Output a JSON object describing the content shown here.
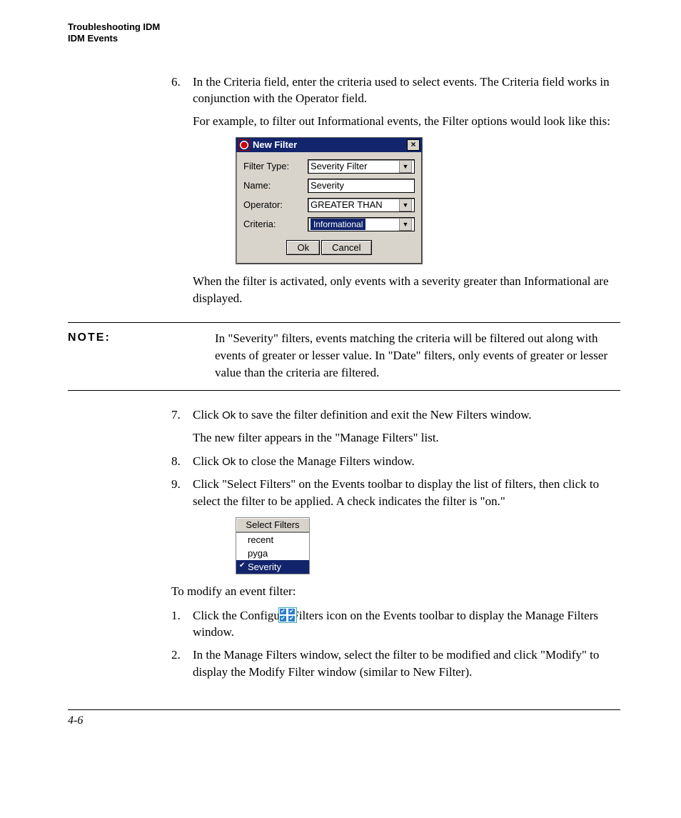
{
  "header": {
    "line1": "Troubleshooting IDM",
    "line2": "IDM Events"
  },
  "steps_a": {
    "6": {
      "num": "6.",
      "text": "In the Criteria field, enter the criteria used to select events. The Criteria field works in conjunction with the Operator field.",
      "example_intro": "For example, to filter out Informational events, the Filter options would look like this:",
      "after_dialog": "When the filter is activated, only events with a severity greater than Informational are displayed."
    }
  },
  "dialog": {
    "title": "New Filter",
    "labels": {
      "filter_type": "Filter Type:",
      "name": "Name:",
      "operator": "Operator:",
      "criteria": "Criteria:"
    },
    "values": {
      "filter_type": "Severity Filter",
      "name": "Severity",
      "operator": "GREATER THAN",
      "criteria": "Informational"
    },
    "buttons": {
      "ok": "Ok",
      "cancel": "Cancel"
    }
  },
  "note": {
    "label": "NOTE:",
    "text": "In \"Severity\" filters, events matching the criteria will be filtered out along with events of greater or lesser value. In \"Date\" filters, only events of greater or lesser value than the criteria are filtered."
  },
  "steps_b": {
    "7": {
      "num": "7.",
      "pre": "Click ",
      "ui": "Ok",
      "post": " to save the filter definition and exit the New Filters window.",
      "extra": "The new filter appears in the \"Manage Filters\" list."
    },
    "8": {
      "num": "8.",
      "pre": "Click ",
      "ui": "Ok",
      "post": " to close the Manage Filters window."
    },
    "9": {
      "num": "9.",
      "text": "Click \"Select Filters\" on the Events toolbar to display the list of filters, then click to select the filter to be applied. A check indicates the filter is \"on.\""
    }
  },
  "select_filters": {
    "button": "Select Filters",
    "items": [
      "recent",
      "pyga",
      "Severity"
    ],
    "selected_index": 2
  },
  "modify_intro": "To modify an event filter:",
  "steps_c": {
    "1": {
      "num": "1.",
      "text": "Click the Configure Filters icon on the Events toolbar to display the Manage Filters window."
    },
    "2": {
      "num": "2.",
      "text": "In the Manage Filters window, select the filter to be modified and click \"Modify\" to display the Modify Filter window (similar to New Filter)."
    }
  },
  "footer": {
    "page": "4-6"
  }
}
